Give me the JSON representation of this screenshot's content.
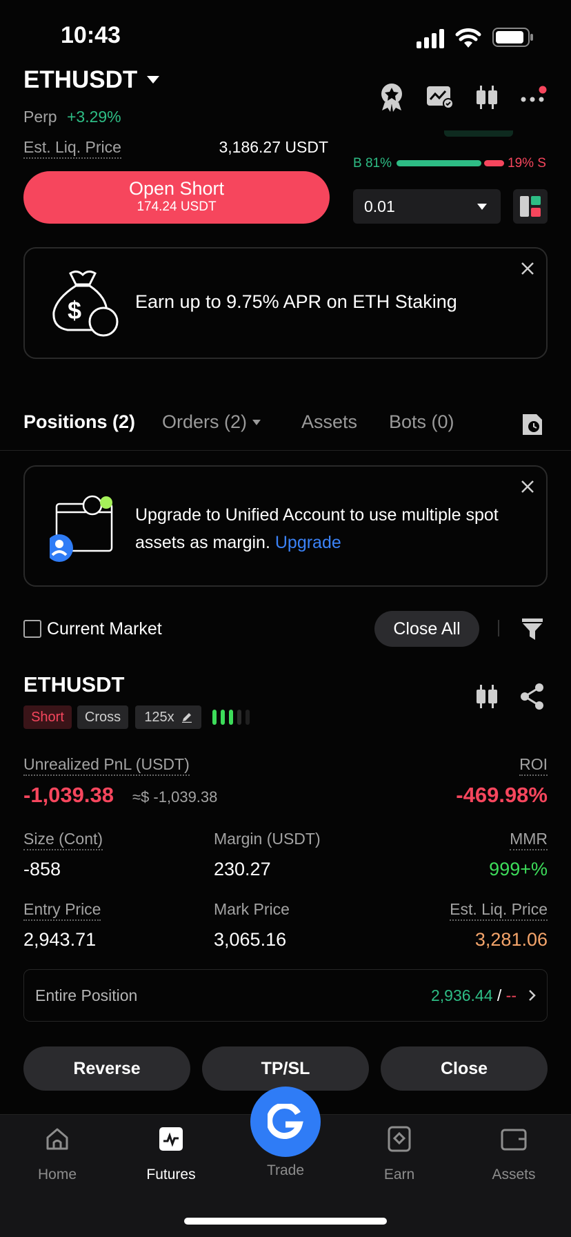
{
  "status_bar": {
    "time": "10:43"
  },
  "header": {
    "symbol": "ETHUSDT",
    "type_label": "Perp",
    "change": "+3.29%",
    "liq_label": "Est. Liq. Price",
    "liq_value": "3,186.27 USDT"
  },
  "order_panel": {
    "open_short_label": "Open Short",
    "open_short_amount": "174.24 USDT",
    "buy_ratio": "B 81%",
    "sell_ratio": "19% S",
    "buy_fraction": 0.81,
    "qty_value": "0.01"
  },
  "promo": {
    "text": "Earn up to 9.75% APR on ETH Staking"
  },
  "tabs": [
    {
      "label": "Positions (2)"
    },
    {
      "label": "Orders (2)"
    },
    {
      "label": "Assets"
    },
    {
      "label": "Bots (0)"
    }
  ],
  "upgrade_banner": {
    "text": "Upgrade to Unified Account to use multiple spot assets as margin.",
    "link": "Upgrade"
  },
  "filter": {
    "checkbox_label": "Current Market",
    "close_all_label": "Close All"
  },
  "position": {
    "symbol": "ETHUSDT",
    "side": "Short",
    "margin_mode": "Cross",
    "leverage": "125x",
    "pnl_label": "Unrealized PnL (USDT)",
    "pnl_value": "-1,039.38",
    "pnl_usd": "≈$ -1,039.38",
    "roi_label": "ROI",
    "roi_value": "-469.98%",
    "size_label": "Size (Cont)",
    "size_value": "-858",
    "margin_label": "Margin (USDT)",
    "margin_value": "230.27",
    "mmr_label": "MMR",
    "mmr_value": "999+%",
    "entry_label": "Entry Price",
    "entry_value": "2,943.71",
    "mark_label": "Mark Price",
    "mark_value": "3,065.16",
    "liq_label": "Est. Liq. Price",
    "liq_value": "3,281.06",
    "tpsl_label": "Entire Position",
    "tp_value": "2,936.44",
    "sl_separator": " / ",
    "sl_value": "--"
  },
  "actions": {
    "reverse": "Reverse",
    "tpsl": "TP/SL",
    "close": "Close"
  },
  "bottom_nav": [
    {
      "label": "Home",
      "icon": "home-icon"
    },
    {
      "label": "Futures",
      "icon": "futures-icon"
    },
    {
      "label": "Trade",
      "icon": "trade-icon"
    },
    {
      "label": "Earn",
      "icon": "earn-icon"
    },
    {
      "label": "Assets",
      "icon": "wallet-icon"
    }
  ],
  "colors": {
    "green": "#2ebd85",
    "red": "#f6465d",
    "blue": "#2f7cf6",
    "orange": "#f5a56b",
    "lime": "#3ddc5a"
  }
}
